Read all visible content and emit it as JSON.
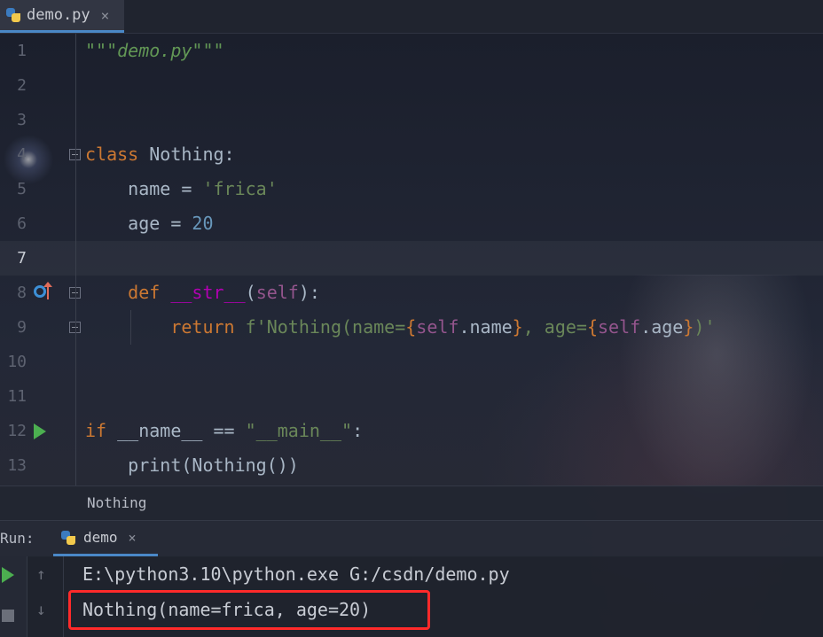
{
  "tab": {
    "label": "demo.py",
    "close": "×"
  },
  "editor": {
    "line_numbers": [
      "1",
      "2",
      "3",
      "4",
      "5",
      "6",
      "7",
      "8",
      "9",
      "10",
      "11",
      "12",
      "13"
    ],
    "line1_doc": "\"\"\"demo.py\"\"\"",
    "line4_kw": "class",
    "line4_name": " Nothing:",
    "line5_indent": "    name = ",
    "line5_str": "'frica'",
    "line6_indent": "    age = ",
    "line6_num": "20",
    "line8_indent": "    ",
    "line8_kw": "def",
    "line8_sp": " ",
    "line8_magic": "__str__",
    "line8_p1": "(",
    "line8_self": "self",
    "line8_p2": "):",
    "line9_indent": "        ",
    "line9_kw": "return",
    "line9_a": " f'Nothing(name=",
    "line9_b1": "{",
    "line9_self1": "self",
    "line9_attr1": ".name",
    "line9_b2": "}",
    "line9_c": ", age=",
    "line9_b3": "{",
    "line9_self2": "self",
    "line9_attr2": ".age",
    "line9_b4": "}",
    "line9_d": ")'",
    "line12_kw": "if",
    "line12_a": " __name__ == ",
    "line12_str": "\"__main__\"",
    "line12_b": ":",
    "line13_code": "    print(Nothing())"
  },
  "breadcrumb": {
    "label": "Nothing"
  },
  "run_panel": {
    "label": "Run:",
    "tab_label": "demo",
    "tab_close": "×"
  },
  "console": {
    "command": "E:\\python3.10\\python.exe G:/csdn/demo.py",
    "output": "Nothing(name=frica, age=20)",
    "up_arrow": "↑",
    "down_arrow": "↓"
  },
  "colors": {
    "keyword": "#cc7832",
    "string": "#6a8759",
    "number": "#6897bb",
    "self": "#94558d",
    "magic": "#b200b2",
    "highlight": "#ff2a2a"
  }
}
